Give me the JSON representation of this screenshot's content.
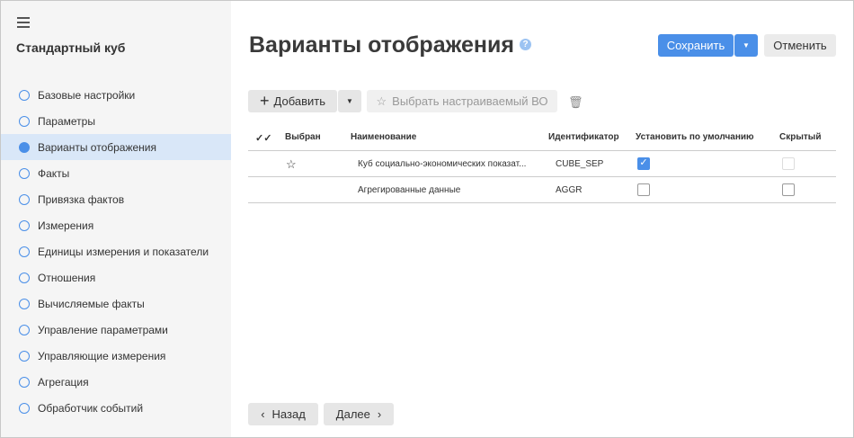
{
  "sidebar": {
    "title": "Стандартный куб",
    "items": [
      {
        "label": "Базовые настройки",
        "selected": false
      },
      {
        "label": "Параметры",
        "selected": false
      },
      {
        "label": "Варианты отображения",
        "selected": true
      },
      {
        "label": "Факты",
        "selected": false
      },
      {
        "label": "Привязка фактов",
        "selected": false
      },
      {
        "label": "Измерения",
        "selected": false
      },
      {
        "label": "Единицы измерения и показатели",
        "selected": false
      },
      {
        "label": "Отношения",
        "selected": false
      },
      {
        "label": "Вычисляемые факты",
        "selected": false
      },
      {
        "label": "Управление параметрами",
        "selected": false
      },
      {
        "label": "Управляющие измерения",
        "selected": false
      },
      {
        "label": "Агрегация",
        "selected": false
      },
      {
        "label": "Обработчик событий",
        "selected": false
      }
    ]
  },
  "header": {
    "title": "Варианты отображения",
    "save": "Сохранить",
    "cancel": "Отменить"
  },
  "toolbar": {
    "add": "Добавить",
    "pick": "Выбрать настраиваемый ВО"
  },
  "table": {
    "columns": [
      "Выбран",
      "Наименование",
      "Идентификатор",
      "Установить по умолчанию",
      "Скрытый"
    ],
    "rows": [
      {
        "selected": true,
        "name": "Куб социально-экономических показат...",
        "id": "CUBE_SEP",
        "default": true,
        "hidden": false,
        "hidden_disabled": true
      },
      {
        "selected": false,
        "name": "Агрегированные данные",
        "id": "AGGR",
        "default": false,
        "hidden": false,
        "hidden_disabled": false
      }
    ]
  },
  "footer": {
    "back": "Назад",
    "next": "Далее"
  },
  "colors": {
    "accent": "#4a8fe8",
    "selected_bg": "#d9e7f8"
  }
}
